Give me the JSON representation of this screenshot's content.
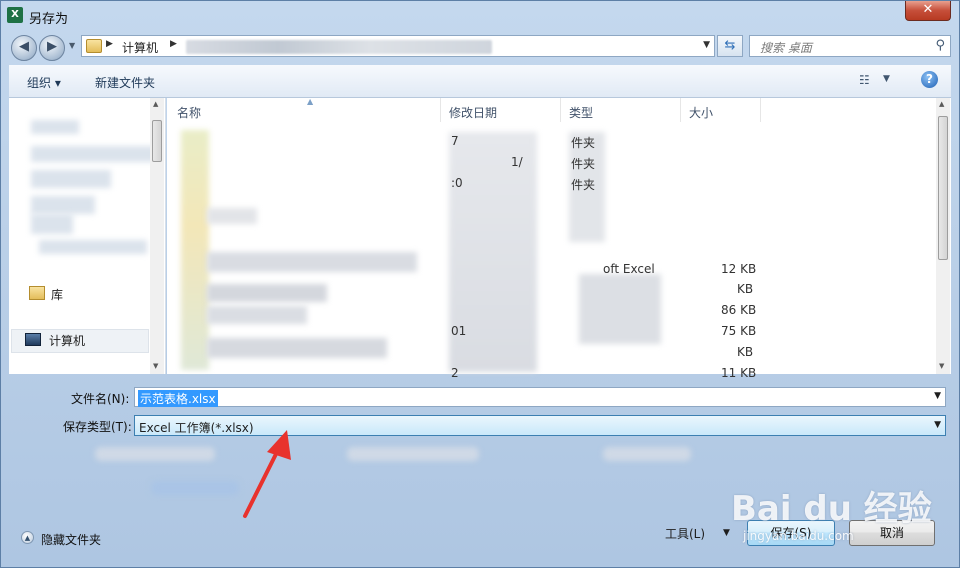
{
  "window": {
    "title": "另存为",
    "close_glyph": "✕",
    "app_icon_label": "X"
  },
  "address": {
    "crumb": "计算机",
    "search_placeholder": "搜索 桌面"
  },
  "toolbar": {
    "organize": "组织 ▾",
    "new_folder": "新建文件夹",
    "view_glyph": "☷",
    "help_glyph": "?"
  },
  "nav": {
    "library": "库",
    "computer": "计算机"
  },
  "columns": {
    "name": "名称",
    "modified": "修改日期",
    "type": "类型",
    "size": "大小"
  },
  "files": {
    "type_fragments": [
      "件夹",
      "件夹",
      "件夹"
    ],
    "type_excel": "oft Excel",
    "sizes": [
      "12 KB",
      "KB",
      "86 KB",
      "75 KB",
      "KB",
      "11 KB"
    ],
    "date_fragments": [
      "7",
      "1/",
      ":0",
      "01",
      "2"
    ]
  },
  "form": {
    "filename_label": "文件名(N):",
    "filename_value": "示范表格.xlsx",
    "filetype_label": "保存类型(T):",
    "filetype_value": "Excel 工作簿(*.xlsx)"
  },
  "footer": {
    "hide_folders": "隐藏文件夹",
    "tools": "工具(L)",
    "save": "保存(S)",
    "cancel": "取消"
  },
  "watermark": {
    "main": "Bai du 经验",
    "sub": "jingyan.baidu.com"
  },
  "colors": {
    "accent": "#3399ff",
    "annotation_arrow": "#e8322d"
  }
}
